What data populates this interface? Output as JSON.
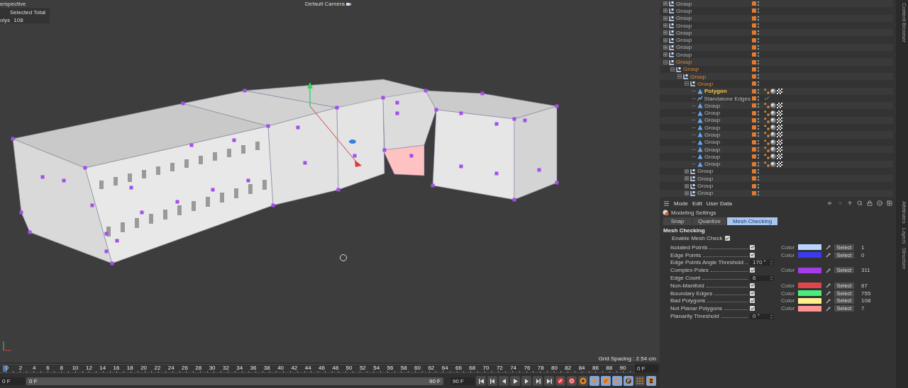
{
  "viewport": {
    "view_name": "erspective",
    "camera": "Default Camera",
    "hud": {
      "header": "Selected Total",
      "label": "olys",
      "value": "108"
    },
    "grid_spacing": "Grid Spacing : 2.54 cm"
  },
  "timeline": {
    "ruler_labels": [
      "0",
      "2",
      "4",
      "6",
      "8",
      "10",
      "12",
      "14",
      "16",
      "18",
      "20",
      "22",
      "24",
      "26",
      "28",
      "30",
      "32",
      "34",
      "36",
      "38",
      "40",
      "42",
      "44",
      "46",
      "48",
      "50",
      "52",
      "54",
      "56",
      "58",
      "60",
      "62",
      "64",
      "66",
      "68",
      "70",
      "72",
      "74",
      "76",
      "78",
      "80",
      "82",
      "84",
      "86",
      "88",
      "90"
    ],
    "current_frame": "0 F",
    "start_field": "0 F",
    "range_start": "0 F",
    "range_end": "90 F",
    "end_field": "90 F",
    "transport": [
      {
        "kind": "first",
        "on": false
      },
      {
        "kind": "prev-key",
        "on": false
      },
      {
        "kind": "prev-frame",
        "on": false
      },
      {
        "kind": "play",
        "on": false
      },
      {
        "kind": "next-frame",
        "on": false
      },
      {
        "kind": "next-key",
        "on": false
      },
      {
        "kind": "last",
        "on": false
      },
      {
        "kind": "record",
        "on": false
      },
      {
        "kind": "autokey",
        "on": false
      },
      {
        "kind": "keyframe",
        "on": false
      },
      {
        "kind": "move",
        "on": true
      },
      {
        "kind": "scale",
        "on": true
      },
      {
        "kind": "rotate",
        "on": true
      },
      {
        "kind": "param",
        "on": true
      },
      {
        "kind": "pla",
        "on": false
      },
      {
        "kind": "film",
        "on": true
      }
    ]
  },
  "side_tabs_top": [
    "Content Browser"
  ],
  "side_tabs": [
    "Attributes",
    "Layers",
    "Structure"
  ],
  "objects": [
    {
      "name": "Group",
      "kind": "null",
      "expanded": false,
      "selected": false
    },
    {
      "name": "Group",
      "kind": "null",
      "expanded": false,
      "selected": false
    },
    {
      "name": "Group",
      "kind": "null",
      "expanded": false,
      "selected": false
    },
    {
      "name": "Group",
      "kind": "null",
      "expanded": false,
      "selected": false
    },
    {
      "name": "Group",
      "kind": "null",
      "expanded": false,
      "selected": false
    },
    {
      "name": "Group",
      "kind": "null",
      "expanded": false,
      "selected": false
    },
    {
      "name": "Group",
      "kind": "null",
      "expanded": false,
      "selected": false
    },
    {
      "name": "Group",
      "kind": "null",
      "expanded": false,
      "selected": false
    },
    {
      "name": "Group",
      "kind": "null",
      "expanded": true,
      "selected": false,
      "children": [
        {
          "name": "Group",
          "kind": "null",
          "expanded": true,
          "selected": false,
          "children": [
            {
              "name": "Group",
              "kind": "null",
              "expanded": true,
              "selected": false,
              "children": [
                {
                  "name": "Group",
                  "kind": "null",
                  "expanded": true,
                  "selected": false,
                  "children": [
                    {
                      "name": "Polygon",
                      "kind": "polygon",
                      "selected": true,
                      "tags": [
                        {
                          "kind": "vertex-map"
                        },
                        {
                          "kind": "material"
                        },
                        {
                          "kind": "checker"
                        }
                      ]
                    },
                    {
                      "name": "Standalone Edges",
                      "kind": "edges",
                      "selected": false,
                      "tags": [
                        {
                          "kind": "check"
                        }
                      ]
                    },
                    {
                      "name": "Group",
                      "kind": "polygon",
                      "selected": false,
                      "tags": [
                        {
                          "kind": "vertex-map"
                        },
                        {
                          "kind": "material"
                        },
                        {
                          "kind": "checker"
                        }
                      ]
                    },
                    {
                      "name": "Group",
                      "kind": "polygon",
                      "selected": false,
                      "tags": [
                        {
                          "kind": "vertex-map"
                        },
                        {
                          "kind": "material"
                        },
                        {
                          "kind": "checker"
                        }
                      ]
                    },
                    {
                      "name": "Group",
                      "kind": "polygon",
                      "selected": false,
                      "tags": [
                        {
                          "kind": "vertex-map"
                        },
                        {
                          "kind": "material"
                        },
                        {
                          "kind": "checker"
                        }
                      ]
                    },
                    {
                      "name": "Group",
                      "kind": "polygon",
                      "selected": false,
                      "tags": [
                        {
                          "kind": "vertex-map"
                        },
                        {
                          "kind": "material"
                        },
                        {
                          "kind": "checker"
                        }
                      ]
                    },
                    {
                      "name": "Group",
                      "kind": "polygon",
                      "selected": false,
                      "tags": [
                        {
                          "kind": "vertex-map"
                        },
                        {
                          "kind": "material"
                        },
                        {
                          "kind": "checker"
                        }
                      ]
                    },
                    {
                      "name": "Group",
                      "kind": "polygon",
                      "selected": false,
                      "tags": [
                        {
                          "kind": "vertex-map"
                        },
                        {
                          "kind": "material"
                        },
                        {
                          "kind": "checker"
                        }
                      ]
                    },
                    {
                      "name": "Group",
                      "kind": "polygon",
                      "selected": false,
                      "tags": [
                        {
                          "kind": "vertex-map"
                        },
                        {
                          "kind": "material"
                        },
                        {
                          "kind": "checker"
                        }
                      ]
                    },
                    {
                      "name": "Group",
                      "kind": "polygon",
                      "selected": false,
                      "tags": [
                        {
                          "kind": "vertex-map"
                        },
                        {
                          "kind": "material"
                        },
                        {
                          "kind": "checker"
                        }
                      ]
                    },
                    {
                      "name": "Group",
                      "kind": "polygon",
                      "selected": false,
                      "tags": [
                        {
                          "kind": "vertex-map"
                        },
                        {
                          "kind": "material"
                        },
                        {
                          "kind": "checker"
                        }
                      ]
                    }
                  ]
                },
                {
                  "name": "Group",
                  "kind": "null",
                  "expanded": false,
                  "selected": false
                },
                {
                  "name": "Group",
                  "kind": "null",
                  "expanded": false,
                  "selected": false
                },
                {
                  "name": "Group",
                  "kind": "null",
                  "expanded": false,
                  "selected": false
                },
                {
                  "name": "Group",
                  "kind": "null",
                  "expanded": false,
                  "selected": false
                }
              ]
            }
          ]
        }
      ]
    }
  ],
  "attributes": {
    "menu": [
      "Mode",
      "Edit",
      "User Data"
    ],
    "title": "Modeling Settings",
    "tabs": [
      {
        "label": "Snap",
        "selected": false
      },
      {
        "label": "Quantize",
        "selected": false
      },
      {
        "label": "Mesh Checking",
        "selected": true
      }
    ],
    "section": "Mesh Checking",
    "enable": {
      "label": "Enable Mesh Check",
      "checked": true
    },
    "rows": [
      {
        "kind": "check",
        "label": "Isolated Points",
        "checked": true,
        "color_label": "Color",
        "color": "#b8d6ff",
        "button": "Select",
        "count": "1"
      },
      {
        "kind": "check",
        "label": "Edge Points",
        "checked": true,
        "color_label": "Color",
        "color": "#3a3af0",
        "button": "Select",
        "count": "0"
      },
      {
        "kind": "number",
        "label": "Edge Points Angle Threshold",
        "value": "170 °"
      },
      {
        "kind": "check",
        "label": "Complex Poles",
        "checked": true,
        "color_label": "Color",
        "color": "#a63ce8",
        "button": "Select",
        "count": "311"
      },
      {
        "kind": "number",
        "label": "Edge Count",
        "value": "6"
      },
      {
        "kind": "check",
        "label": "Non-Manifold",
        "checked": true,
        "color_label": "Color",
        "color": "#e0444c",
        "button": "Select",
        "count": "87"
      },
      {
        "kind": "check",
        "label": "Boundary Edges",
        "checked": true,
        "color_label": "Color",
        "color": "#48ee7a",
        "button": "Select",
        "count": "755"
      },
      {
        "kind": "check",
        "label": "Bad Polygons",
        "checked": true,
        "color_label": "Color",
        "color": "#fff08c",
        "button": "Select",
        "count": "108"
      },
      {
        "kind": "check",
        "label": "Not Planar Polygons",
        "checked": true,
        "color_label": "Color",
        "color": "#ff9494",
        "button": "Select",
        "count": "7"
      },
      {
        "kind": "number",
        "label": "Planarity Threshold",
        "value": "0 °"
      }
    ]
  }
}
